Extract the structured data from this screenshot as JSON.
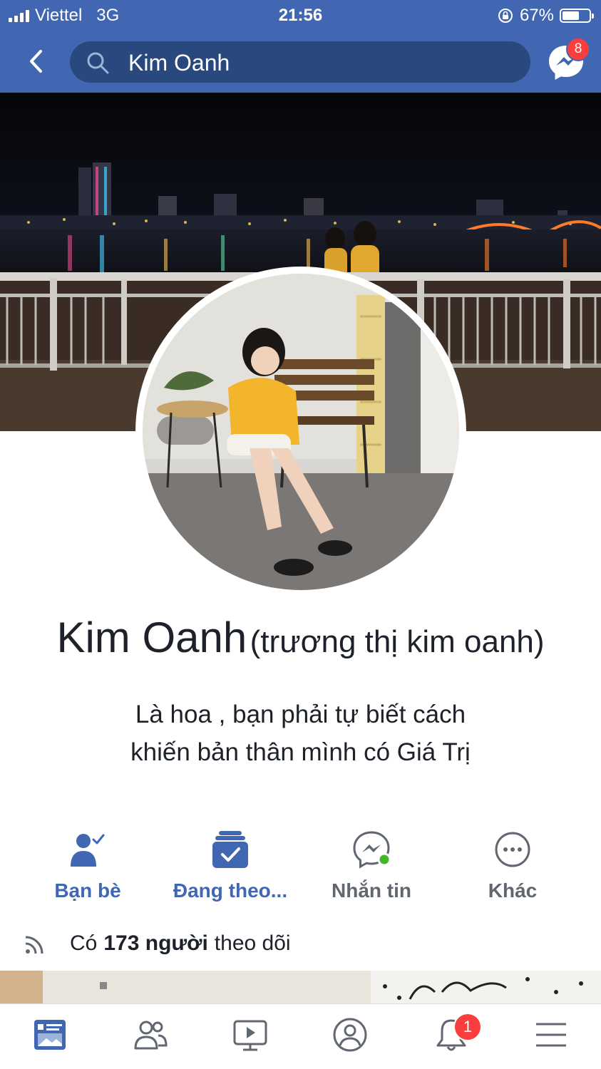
{
  "status_bar": {
    "carrier": "Viettel",
    "network": "3G",
    "time": "21:56",
    "battery": "67%",
    "battery_level": 0.67
  },
  "header": {
    "search_text": "Kim Oanh",
    "messenger_badge": "8"
  },
  "profile": {
    "name": "Kim Oanh",
    "alternate_name": "(trương thị kim oanh)",
    "bio_lines": [
      "Là hoa , bạn phải tự biết cách",
      "khiến bản thân mình có Giá Trị"
    ]
  },
  "actions": [
    {
      "label": "Bạn bè",
      "icon": "friends-check-icon"
    },
    {
      "label": "Đang theo...",
      "icon": "following-icon"
    },
    {
      "label": "Nhắn tin",
      "icon": "messenger-icon"
    },
    {
      "label": "Khác",
      "icon": "more-icon"
    }
  ],
  "followers": {
    "prefix": "Có",
    "count": "173 người",
    "suffix": "theo dõi"
  },
  "tab_bar": {
    "tabs": [
      {
        "icon": "news-feed-icon",
        "active": true
      },
      {
        "icon": "friends-icon"
      },
      {
        "icon": "watch-icon"
      },
      {
        "icon": "profile-icon"
      },
      {
        "icon": "notifications-icon",
        "badge": "1"
      },
      {
        "icon": "menu-icon"
      }
    ]
  },
  "colors": {
    "brand": "#4267b2",
    "search_bg": "#29487d",
    "action_blue": "#4267b2",
    "action_gray": "#606770",
    "badge_red": "#fa3e3e",
    "online_green": "#42b72a"
  }
}
